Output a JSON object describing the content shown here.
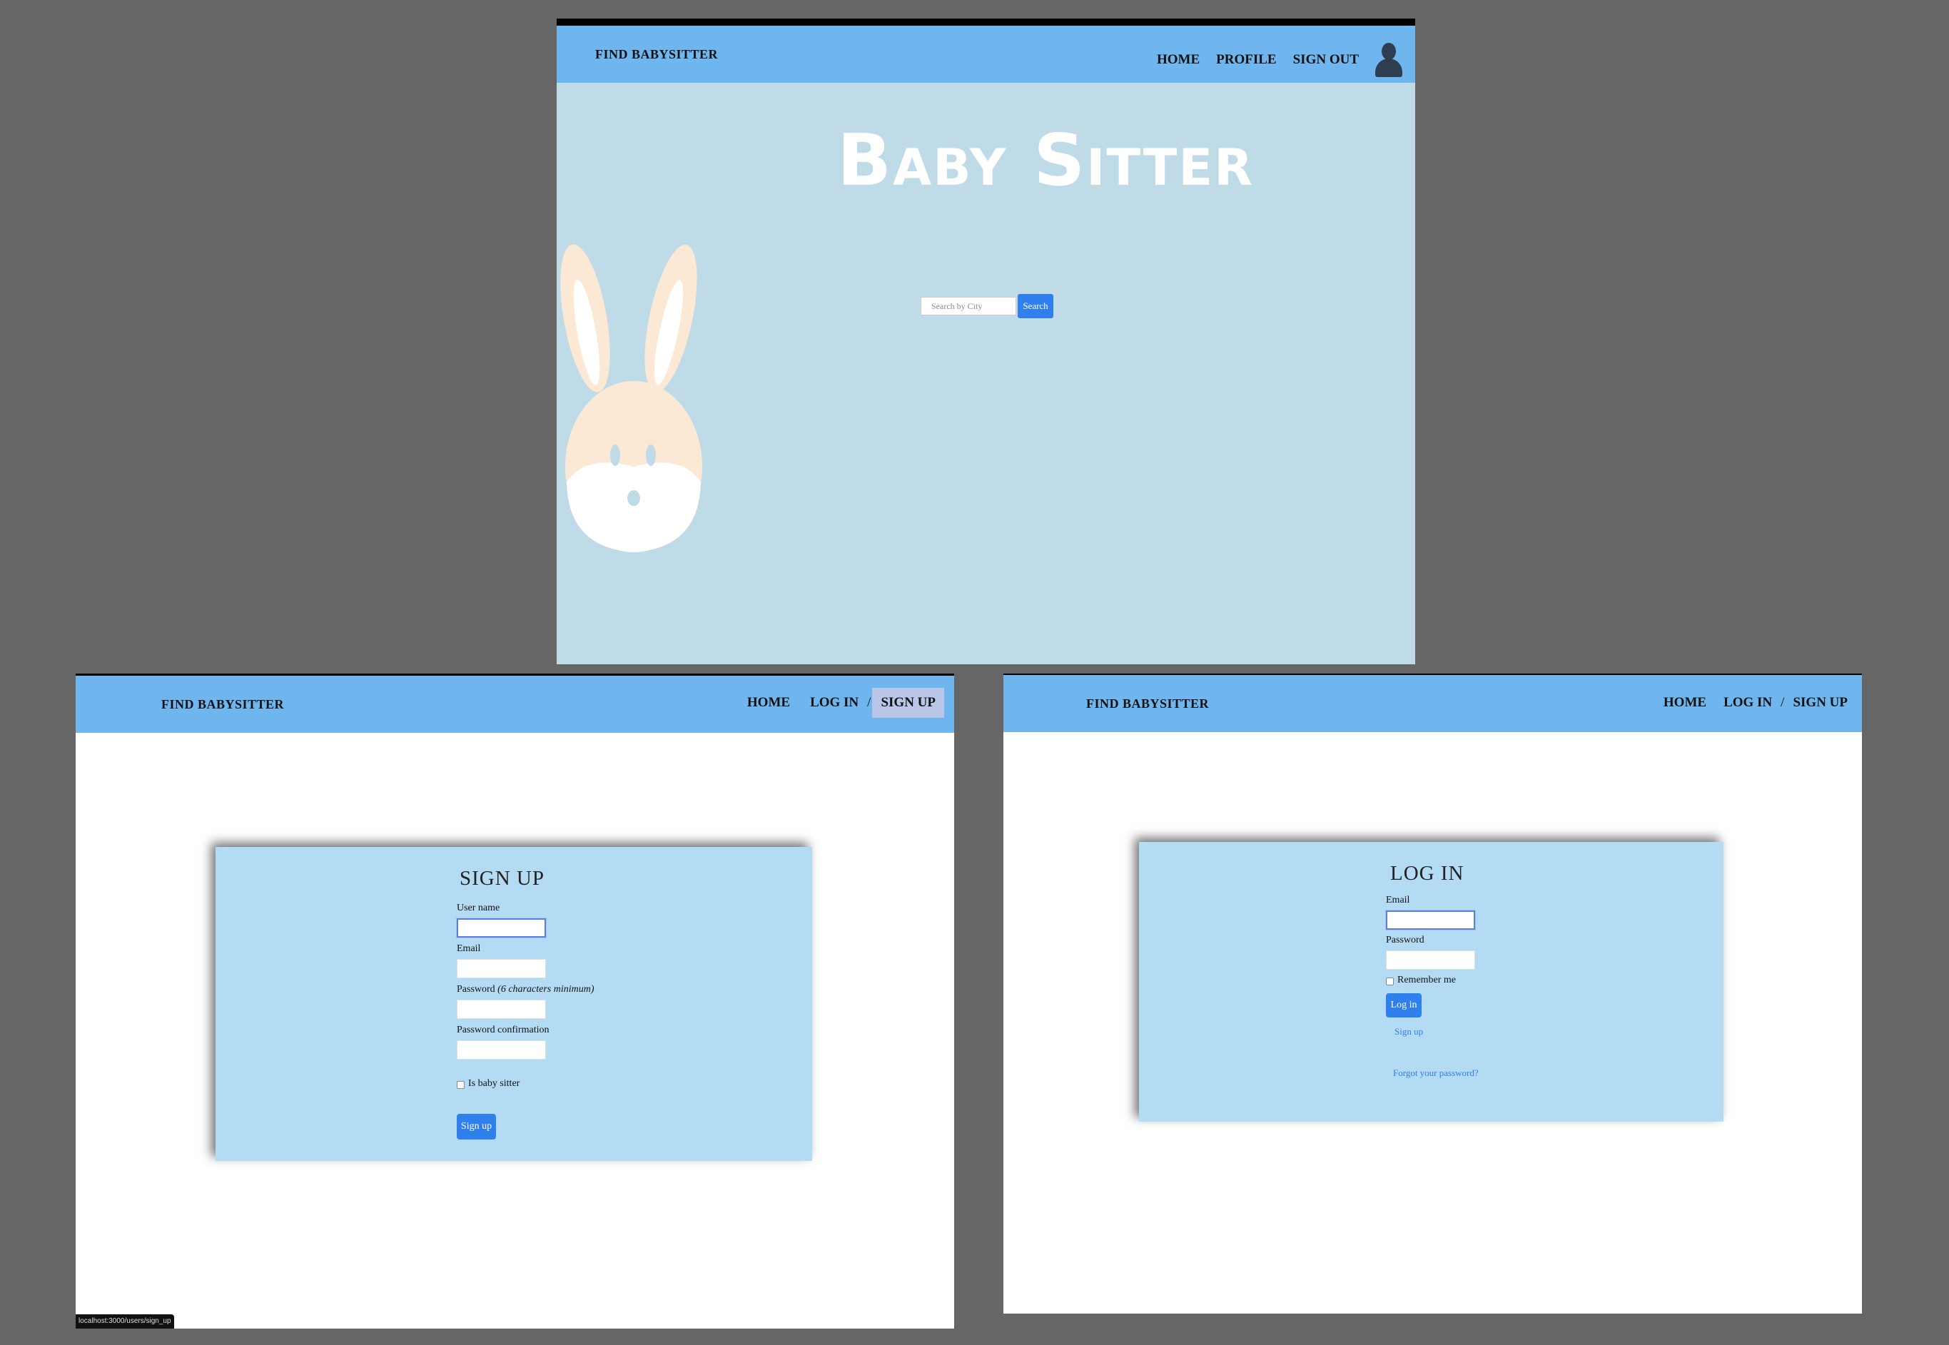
{
  "home": {
    "brand": "FIND BABYSITTER",
    "nav": {
      "home": "HOME",
      "profile": "PROFILE",
      "sign_out": "SIGN OUT"
    },
    "hero_title": "Baby Sitter",
    "search": {
      "placeholder": "Search by City",
      "button": "Search"
    }
  },
  "signup": {
    "brand": "FIND BABYSITTER",
    "nav": {
      "home": "HOME",
      "log_in": "LOG IN",
      "separator": "/",
      "sign_up": "SIGN UP"
    },
    "title": "SIGN UP",
    "fields": {
      "username_label": "User name",
      "email_label": "Email",
      "password_label": "Password",
      "password_hint": "(6 characters minimum)",
      "confirmation_label": "Password confirmation"
    },
    "babysitter_checkbox_label": "Is baby sitter",
    "submit": "Sign up",
    "status_url": "localhost:3000/users/sign_up"
  },
  "login": {
    "brand": "FIND BABYSITTER",
    "nav": {
      "home": "HOME",
      "log_in": "LOG IN",
      "separator": "/",
      "sign_up": "SIGN UP"
    },
    "title": "LOG IN",
    "fields": {
      "email_label": "Email",
      "password_label": "Password"
    },
    "remember_label": "Remember me",
    "submit": "Log in",
    "sign_up_link": "Sign up",
    "forgot_link": "Forgot your password?"
  },
  "colors": {
    "nav_bg": "#6fb5ee",
    "hero_bg": "#c0dbe8",
    "card_bg": "#b4dbf4",
    "button_blue": "#2f80ed",
    "active_tab": "#b9c6e8"
  }
}
